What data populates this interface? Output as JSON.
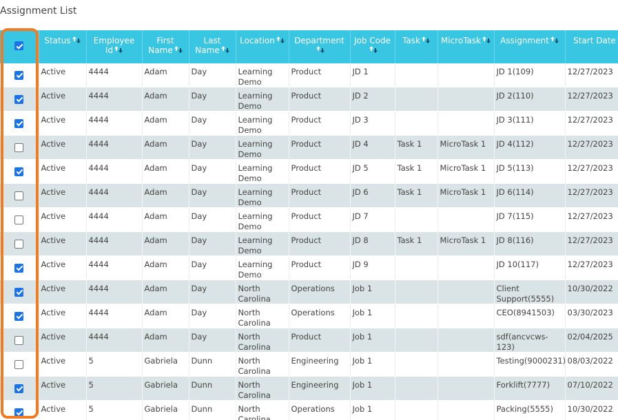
{
  "page": {
    "title": "Assignment List"
  },
  "columns": [
    {
      "key": "status",
      "label": "Status",
      "sortable": true
    },
    {
      "key": "employee_id",
      "label": "Employee Id",
      "sortable": true
    },
    {
      "key": "first_name",
      "label": "First Name",
      "sortable": true
    },
    {
      "key": "last_name",
      "label": "Last Name",
      "sortable": true
    },
    {
      "key": "location",
      "label": "Location",
      "sortable": true
    },
    {
      "key": "department",
      "label": "Department",
      "sortable": true
    },
    {
      "key": "job_code",
      "label": "Job Code",
      "sortable": true
    },
    {
      "key": "task",
      "label": "Task",
      "sortable": true
    },
    {
      "key": "microtask",
      "label": "MicroTask",
      "sortable": true
    },
    {
      "key": "assignment",
      "label": "Assignment",
      "sortable": true
    },
    {
      "key": "start_date",
      "label": "Start Date",
      "sortable": true
    }
  ],
  "header_checkbox": {
    "checked": true
  },
  "rows": [
    {
      "checked": true,
      "status": "Active",
      "employee_id": "4444",
      "first_name": "Adam",
      "last_name": "Day",
      "location": "Learning Demo",
      "department": "Product",
      "job_code": "JD 1",
      "task": "",
      "microtask": "",
      "assignment": "JD 1(109)",
      "start_date": "12/27/2023"
    },
    {
      "checked": true,
      "status": "Active",
      "employee_id": "4444",
      "first_name": "Adam",
      "last_name": "Day",
      "location": "Learning Demo",
      "department": "Product",
      "job_code": "JD 2",
      "task": "",
      "microtask": "",
      "assignment": "JD 2(110)",
      "start_date": "12/27/2023"
    },
    {
      "checked": true,
      "status": "Active",
      "employee_id": "4444",
      "first_name": "Adam",
      "last_name": "Day",
      "location": "Learning Demo",
      "department": "Product",
      "job_code": "JD 3",
      "task": "",
      "microtask": "",
      "assignment": "JD 3(111)",
      "start_date": "12/27/2023"
    },
    {
      "checked": false,
      "status": "Active",
      "employee_id": "4444",
      "first_name": "Adam",
      "last_name": "Day",
      "location": "Learning Demo",
      "department": "Product",
      "job_code": "JD 4",
      "task": "Task 1",
      "microtask": "MicroTask 1",
      "assignment": "JD 4(112)",
      "start_date": "12/27/2023"
    },
    {
      "checked": true,
      "status": "Active",
      "employee_id": "4444",
      "first_name": "Adam",
      "last_name": "Day",
      "location": "Learning Demo",
      "department": "Product",
      "job_code": "JD 5",
      "task": "Task 1",
      "microtask": "MicroTask 1",
      "assignment": "JD 5(113)",
      "start_date": "12/27/2023"
    },
    {
      "checked": false,
      "status": "Active",
      "employee_id": "4444",
      "first_name": "Adam",
      "last_name": "Day",
      "location": "Learning Demo",
      "department": "Product",
      "job_code": "JD 6",
      "task": "Task 1",
      "microtask": "MicroTask 1",
      "assignment": "JD 6(114)",
      "start_date": "12/27/2023"
    },
    {
      "checked": false,
      "status": "Active",
      "employee_id": "4444",
      "first_name": "Adam",
      "last_name": "Day",
      "location": "Learning Demo",
      "department": "Product",
      "job_code": "JD 7",
      "task": "",
      "microtask": "",
      "assignment": "JD 7(115)",
      "start_date": "12/27/2023"
    },
    {
      "checked": false,
      "status": "Active",
      "employee_id": "4444",
      "first_name": "Adam",
      "last_name": "Day",
      "location": "Learning Demo",
      "department": "Product",
      "job_code": "JD 8",
      "task": "Task 1",
      "microtask": "MicroTask 1",
      "assignment": "JD 8(116)",
      "start_date": "12/27/2023"
    },
    {
      "checked": true,
      "status": "Active",
      "employee_id": "4444",
      "first_name": "Adam",
      "last_name": "Day",
      "location": "Learning Demo",
      "department": "Product",
      "job_code": "JD 9",
      "task": "",
      "microtask": "",
      "assignment": "JD 10(117)",
      "start_date": "12/27/2023"
    },
    {
      "checked": true,
      "status": "Active",
      "employee_id": "4444",
      "first_name": "Adam",
      "last_name": "Day",
      "location": "North Carolina",
      "department": "Operations",
      "job_code": "Job 1",
      "task": "",
      "microtask": "",
      "assignment": "Client Support(5555)",
      "start_date": "10/30/2022"
    },
    {
      "checked": true,
      "status": "Active",
      "employee_id": "4444",
      "first_name": "Adam",
      "last_name": "Day",
      "location": "North Carolina",
      "department": "Operations",
      "job_code": "Job 1",
      "task": "",
      "microtask": "",
      "assignment": "CEO(8941503)",
      "start_date": "03/30/2023"
    },
    {
      "checked": false,
      "status": "Active",
      "employee_id": "4444",
      "first_name": "Adam",
      "last_name": "Day",
      "location": "North Carolina",
      "department": "Product",
      "job_code": "Job 1",
      "task": "",
      "microtask": "",
      "assignment": "sdf(ancvcws-123)",
      "start_date": "02/04/2025"
    },
    {
      "checked": false,
      "status": "Active",
      "employee_id": "5",
      "first_name": "Gabriela",
      "last_name": "Dunn",
      "location": "North Carolina",
      "department": "Engineering",
      "job_code": "Job 1",
      "task": "",
      "microtask": "",
      "assignment": "Testing(9000231)",
      "start_date": "08/03/2022"
    },
    {
      "checked": true,
      "status": "Active",
      "employee_id": "5",
      "first_name": "Gabriela",
      "last_name": "Dunn",
      "location": "North Carolina",
      "department": "Engineering",
      "job_code": "Job 1",
      "task": "",
      "microtask": "",
      "assignment": "Forklift(7777)",
      "start_date": "07/10/2022"
    },
    {
      "checked": true,
      "status": "Active",
      "employee_id": "5",
      "first_name": "Gabriela",
      "last_name": "Dunn",
      "location": "North Carolina",
      "department": "Operations",
      "job_code": "Job 1",
      "task": "",
      "microtask": "",
      "assignment": "Packing(5555)",
      "start_date": "10/30/2022"
    }
  ],
  "colors": {
    "header_bg": "#38c6e2",
    "stripe_bg": "#dae3e5",
    "checkbox_checked": "#1a73e8",
    "highlight": "#f07b22"
  }
}
